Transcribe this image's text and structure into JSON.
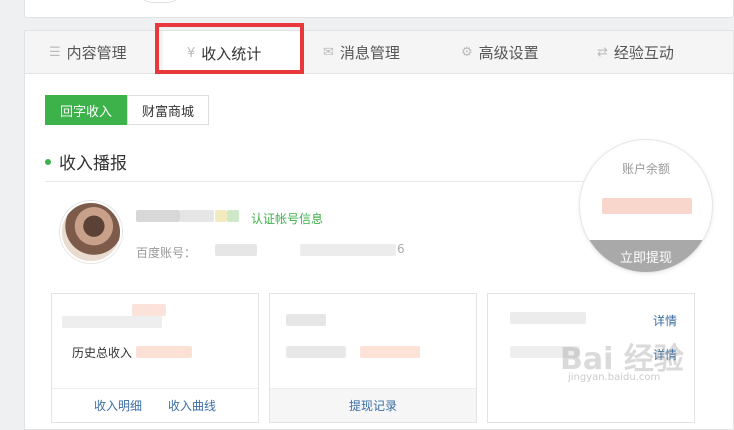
{
  "tabs": [
    {
      "label": "内容管理",
      "icon": "list-icon"
    },
    {
      "label": "收入统计",
      "icon": "yen-icon"
    },
    {
      "label": "消息管理",
      "icon": "mail-icon"
    },
    {
      "label": "高级设置",
      "icon": "gear-icon"
    },
    {
      "label": "经验互动",
      "icon": "swap-icon"
    }
  ],
  "subtabs": [
    "回字收入",
    "财富商城"
  ],
  "section": {
    "title": "收入播报"
  },
  "user": {
    "verify_link": "认证帐号信息",
    "account_prefix": "百度账号：",
    "account_value": "6"
  },
  "balance": {
    "label": "账户余额",
    "withdraw_button": "立即提现"
  },
  "card1": {
    "row2_label": "历史总收入",
    "links": [
      "收入明细",
      "收入曲线"
    ]
  },
  "card2": {
    "link": "提现记录"
  },
  "card3": {
    "detail1": "详情",
    "detail2": "详情"
  },
  "watermark": {
    "text": "Bai 经验",
    "sub": "jingyan.baidu.com"
  }
}
